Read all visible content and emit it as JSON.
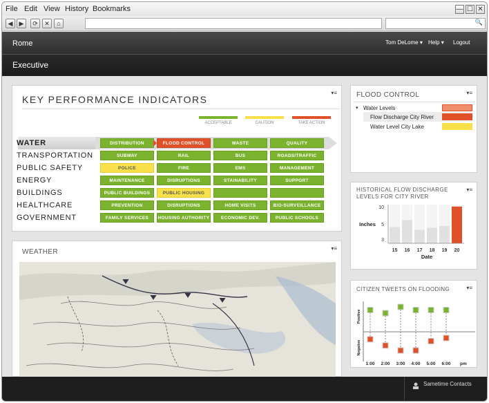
{
  "menu": {
    "file": "File",
    "edit": "Edit",
    "view": "View",
    "history": "History",
    "bookmarks": "Bookmarks"
  },
  "window_controls": {
    "minimize": "—",
    "maximize": "☐",
    "close": "✕"
  },
  "nav": {
    "back": "◀",
    "forward": "▶",
    "reload": "⟳",
    "stop": "✕",
    "home": "⌂"
  },
  "search_icon": "🔍",
  "app": {
    "location": "Rome",
    "user": "Tom DeLome",
    "help": "Help",
    "logout": "Logout",
    "page_title": "Executive",
    "dropdown": "▾"
  },
  "kpi": {
    "title": "KEY PERFORMANCE INDICATORS",
    "menu_icon": "▾≡",
    "legend": [
      {
        "label": "ACCEPTABLE",
        "color": "#7cb32e"
      },
      {
        "label": "CAUTION",
        "color": "#f7e04a"
      },
      {
        "label": "TAKE ACTION",
        "color": "#e0512a"
      }
    ],
    "rows": [
      {
        "label": "WATER",
        "cells": [
          {
            "t": "DISTRIBUTION",
            "s": "g"
          },
          {
            "t": "FLOOD CONTROL",
            "s": "r"
          },
          {
            "t": "WASTE",
            "s": "g"
          },
          {
            "t": "QUALITY",
            "s": "g"
          }
        ]
      },
      {
        "label": "TRANSPORTATION",
        "cells": [
          {
            "t": "SUBWAY",
            "s": "g"
          },
          {
            "t": "RAIL",
            "s": "g"
          },
          {
            "t": "BUS",
            "s": "g"
          },
          {
            "t": "ROADS/TRAFFIC",
            "s": "g"
          }
        ]
      },
      {
        "label": "PUBLIC SAFETY",
        "cells": [
          {
            "t": "POLICE",
            "s": "y"
          },
          {
            "t": "FIRE",
            "s": "g"
          },
          {
            "t": "EMS",
            "s": "g"
          },
          {
            "t": "MANAGEMENT",
            "s": "g"
          }
        ]
      },
      {
        "label": "ENERGY",
        "cells": [
          {
            "t": "MAINTENANCE",
            "s": "g"
          },
          {
            "t": "DISRUPTIONS",
            "s": "g"
          },
          {
            "t": "STAINABILITY",
            "s": "g"
          },
          {
            "t": "SUPPORT",
            "s": "g"
          }
        ]
      },
      {
        "label": "BUILDINGS",
        "cells": [
          {
            "t": "PUBLIC BUILDINGS",
            "s": "g"
          },
          {
            "t": "PUBLIC HOUSING",
            "s": "y"
          },
          {
            "t": "",
            "s": "g"
          },
          {
            "t": "",
            "s": "g"
          }
        ]
      },
      {
        "label": "HEALTHCARE",
        "cells": [
          {
            "t": "PREVENTION",
            "s": "g"
          },
          {
            "t": "DISRUPTIONS",
            "s": "g"
          },
          {
            "t": "HOME VISITS",
            "s": "g"
          },
          {
            "t": "BIO-SURVEILLANCE",
            "s": "g"
          }
        ]
      },
      {
        "label": "GOVERNMENT",
        "cells": [
          {
            "t": "FAMILY SERVICES",
            "s": "g"
          },
          {
            "t": "HOUSING AUTHORITY",
            "s": "g"
          },
          {
            "t": "ECONOMIC DEV.",
            "s": "g"
          },
          {
            "t": "PUBLIC SCHOOLS",
            "s": "g"
          }
        ]
      }
    ]
  },
  "weather": {
    "title": "WEATHER",
    "menu_icon": "▾≡"
  },
  "flood": {
    "title": "FLOOD CONTROL",
    "menu_icon": "▾≡",
    "parent": "Water Levels",
    "caret": "▾",
    "items": [
      {
        "label": "Flow Discharge City River",
        "color": "#e0512a"
      },
      {
        "label": "Water Level City Lake",
        "color": "#f7e04a"
      }
    ],
    "parent_color": "#f08f6c"
  },
  "historical": {
    "title_line1": "HISTORICAL FLOW DISCHARGE",
    "title_line2": "LEVELS FOR CITY RIVER",
    "menu_icon": "▾≡"
  },
  "tweets": {
    "title": "CITIZEN TWEETS ON FLOODING",
    "menu_icon": "▾≡",
    "positive": "Positive",
    "negative": "Negative",
    "pm": "pm"
  },
  "footer": {
    "contacts": "Sametime Contacts"
  },
  "chart_data": [
    {
      "type": "bar",
      "title": "HISTORICAL FLOW DISCHARGE LEVELS FOR CITY RIVER",
      "xlabel": "Date",
      "ylabel": "Inches",
      "categories": [
        "15",
        "16",
        "17",
        "18",
        "19",
        "20"
      ],
      "values": [
        4.2,
        6.0,
        3.5,
        4.0,
        4.5,
        9.5
      ],
      "highlight_color": "#e0512a",
      "base_color": "#e0e0e0",
      "yticks": [
        "10",
        "5",
        "3"
      ],
      "ylim": [
        0,
        10
      ]
    },
    {
      "type": "scatter",
      "title": "CITIZEN TWEETS ON FLOODING",
      "categories": [
        "1:00",
        "2:00",
        "3:00",
        "4:00",
        "5:00",
        "6:00"
      ],
      "series": [
        {
          "name": "Positive",
          "values": [
            3.5,
            3.0,
            4.0,
            3.5,
            3.5,
            3.5
          ],
          "color": "#7cb32e"
        },
        {
          "name": "Negative",
          "values": [
            -1.2,
            -2.2,
            -3.0,
            -3.0,
            -1.5,
            -1.0
          ],
          "color": "#e0512a"
        }
      ],
      "ylim": [
        -4,
        5
      ]
    }
  ]
}
